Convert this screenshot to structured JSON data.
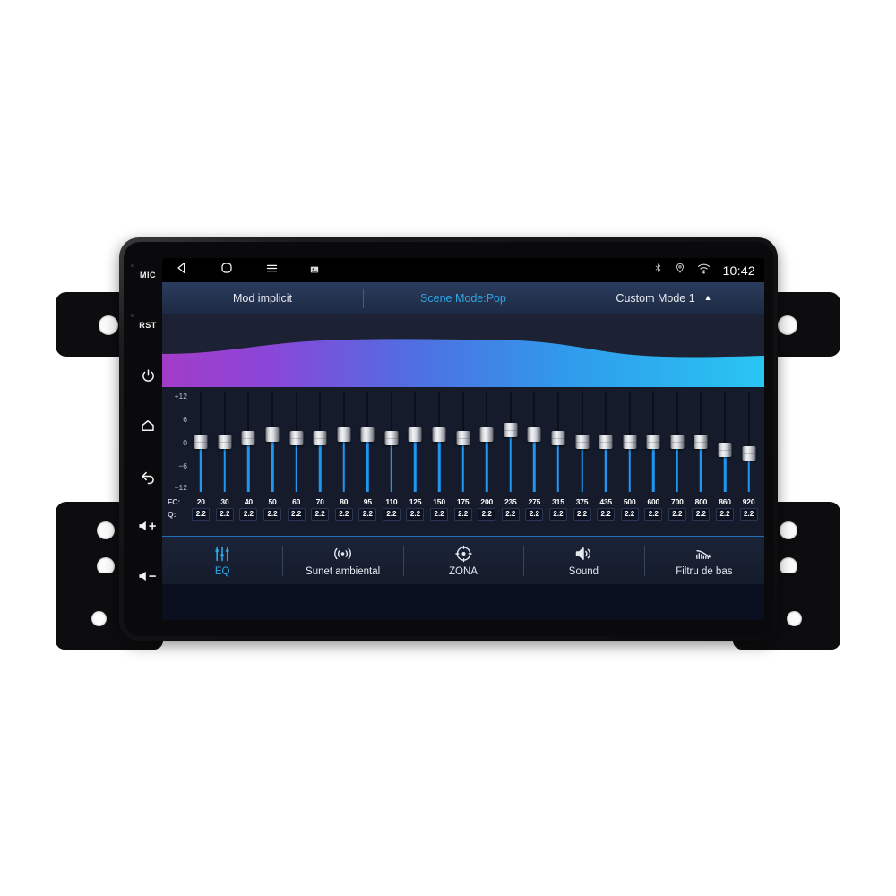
{
  "device": {
    "hardware_keys": [
      {
        "name": "mic",
        "label": "MIC",
        "type": "text"
      },
      {
        "name": "reset",
        "label": "RST",
        "type": "text"
      },
      {
        "name": "power",
        "label": "power-icon",
        "type": "icon"
      },
      {
        "name": "home",
        "label": "home-icon",
        "type": "icon"
      },
      {
        "name": "back",
        "label": "back-icon",
        "type": "icon"
      },
      {
        "name": "volume-up",
        "label": "volume-up-icon",
        "type": "icon"
      },
      {
        "name": "volume-down",
        "label": "volume-down-icon",
        "type": "icon"
      }
    ]
  },
  "statusbar": {
    "nav_icons": [
      "back-icon",
      "home-icon",
      "menu-icon",
      "screenshot-icon"
    ],
    "system_icons": [
      "bluetooth-icon",
      "location-icon",
      "wifi-icon"
    ],
    "clock": "10:42"
  },
  "mode_row": {
    "items": [
      {
        "label": "Mod implicit",
        "active": false,
        "caret": ""
      },
      {
        "label": "Scene Mode:Pop",
        "active": true,
        "caret": ""
      },
      {
        "label": "Custom Mode 1",
        "active": false,
        "caret": "▲"
      }
    ]
  },
  "equalizer": {
    "scale_labels": [
      "+12",
      "6",
      "0",
      "−6",
      "−12"
    ],
    "fc_row_label": "FC:",
    "q_row_label": "Q:",
    "bands": [
      {
        "fc": "20",
        "q": "2.2",
        "gain": 0
      },
      {
        "fc": "30",
        "q": "2.2",
        "gain": 0
      },
      {
        "fc": "40",
        "q": "2.2",
        "gain": 1
      },
      {
        "fc": "50",
        "q": "2.2",
        "gain": 2
      },
      {
        "fc": "60",
        "q": "2.2",
        "gain": 1
      },
      {
        "fc": "70",
        "q": "2.2",
        "gain": 1
      },
      {
        "fc": "80",
        "q": "2.2",
        "gain": 2
      },
      {
        "fc": "95",
        "q": "2.2",
        "gain": 2
      },
      {
        "fc": "110",
        "q": "2.2",
        "gain": 1
      },
      {
        "fc": "125",
        "q": "2.2",
        "gain": 2
      },
      {
        "fc": "150",
        "q": "2.2",
        "gain": 2
      },
      {
        "fc": "175",
        "q": "2.2",
        "gain": 1
      },
      {
        "fc": "200",
        "q": "2.2",
        "gain": 2
      },
      {
        "fc": "235",
        "q": "2.2",
        "gain": 3
      },
      {
        "fc": "275",
        "q": "2.2",
        "gain": 2
      },
      {
        "fc": "315",
        "q": "2.2",
        "gain": 1
      },
      {
        "fc": "375",
        "q": "2.2",
        "gain": 0
      },
      {
        "fc": "435",
        "q": "2.2",
        "gain": 0
      },
      {
        "fc": "500",
        "q": "2.2",
        "gain": 0
      },
      {
        "fc": "600",
        "q": "2.2",
        "gain": 0
      },
      {
        "fc": "700",
        "q": "2.2",
        "gain": 0
      },
      {
        "fc": "800",
        "q": "2.2",
        "gain": 0
      },
      {
        "fc": "860",
        "q": "2.2",
        "gain": -2
      },
      {
        "fc": "920",
        "q": "2.2",
        "gain": -3
      }
    ]
  },
  "tabs": [
    {
      "label": "EQ",
      "icon": "equalizer-sliders-icon",
      "active": true
    },
    {
      "label": "Sunet ambiental",
      "icon": "surround-sound-icon",
      "active": false
    },
    {
      "label": "ZONA",
      "icon": "zone-target-icon",
      "active": false
    },
    {
      "label": "Sound",
      "icon": "speaker-icon",
      "active": false
    },
    {
      "label": "Filtru de bas",
      "icon": "bass-filter-icon",
      "active": false
    }
  ],
  "colors": {
    "accent": "#2fa8e8",
    "slider_track": "#2196f3",
    "wave_left": "#a23cc8",
    "wave_mid": "#4a6ee0",
    "wave_right": "#29c6f2",
    "screen_bg": "#151b2b"
  }
}
